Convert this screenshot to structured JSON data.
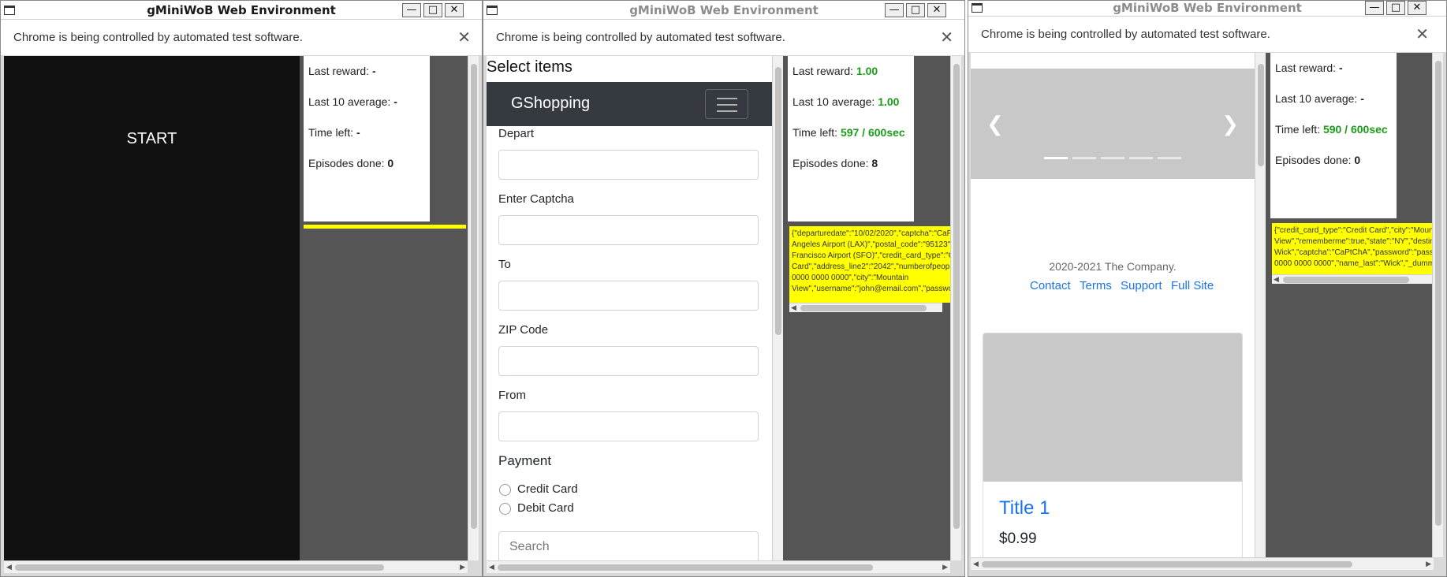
{
  "windows": [
    {
      "title": "gMiniWoB Web Environment",
      "infobar": "Chrome is being controlled by automated test software.",
      "start_label": "START",
      "stats": {
        "last_reward_label": "Last reward:",
        "last_reward": "-",
        "last10_label": "Last 10 average:",
        "last10": "-",
        "time_label": "Time left:",
        "time": "-",
        "episodes_label": "Episodes done:",
        "episodes": "0"
      }
    },
    {
      "title": "gMiniWoB Web Environment",
      "infobar": "Chrome is being controlled by automated test software.",
      "task_title": "Select items",
      "brand": "GShopping",
      "fields": [
        "Depart",
        "Enter Captcha",
        "To",
        "ZIP Code",
        "From"
      ],
      "payment_label": "Payment",
      "payment_options": [
        "Credit Card",
        "Debit Card"
      ],
      "search_placeholder": "Search",
      "stats": {
        "last_reward_label": "Last reward:",
        "last_reward": "1.00",
        "last10_label": "Last 10 average:",
        "last10": "1.00",
        "time_label": "Time left:",
        "time": "597 / 600sec",
        "episodes_label": "Episodes done:",
        "episodes": "8"
      },
      "json_lines": [
        "{\"departuredate\":\"10/02/2020\",\"captcha\":\"CaP",
        "Angeles Airport (LAX)\",\"postal_code\":\"95123\"",
        "Francisco Airport (SFO)\",\"credit_card_type\":\"C",
        "Card\",\"address_line2\":\"2042\",\"numberofpeopl",
        "0000 0000 0000\",\"city\":\"Mountain",
        "View\",\"username\":\"john@email.com\",\"passwo"
      ]
    },
    {
      "title": "gMiniWoB Web Environment",
      "infobar": "Chrome is being controlled by automated test software.",
      "copyright": "2020-2021 The Company.",
      "links": [
        "Contact",
        "Terms",
        "Support",
        "Full Site"
      ],
      "card_title": "Title 1",
      "card_price": "$0.99",
      "stats": {
        "last_reward_label": "Last reward:",
        "last_reward": "-",
        "last10_label": "Last 10 average:",
        "last10": "-",
        "time_label": "Time left:",
        "time": "590 / 600sec",
        "episodes_label": "Episodes done:",
        "episodes": "0"
      },
      "json_lines": [
        "{\"credit_card_type\":\"Credit Card\",\"city\":\"Moun",
        "View\",\"rememberme\":true,\"state\":\"NY\",\"destin",
        "Wick\",\"captcha\":\"CaPtChA\",\"password\":\"pass",
        "0000 0000 0000\",\"name_last\":\"Wick\",\"_dumm"
      ]
    }
  ],
  "colors": {
    "green": "#1a9c1a",
    "yellow": "#ffff00",
    "link": "#1a73e8",
    "navbar": "#343a40"
  }
}
